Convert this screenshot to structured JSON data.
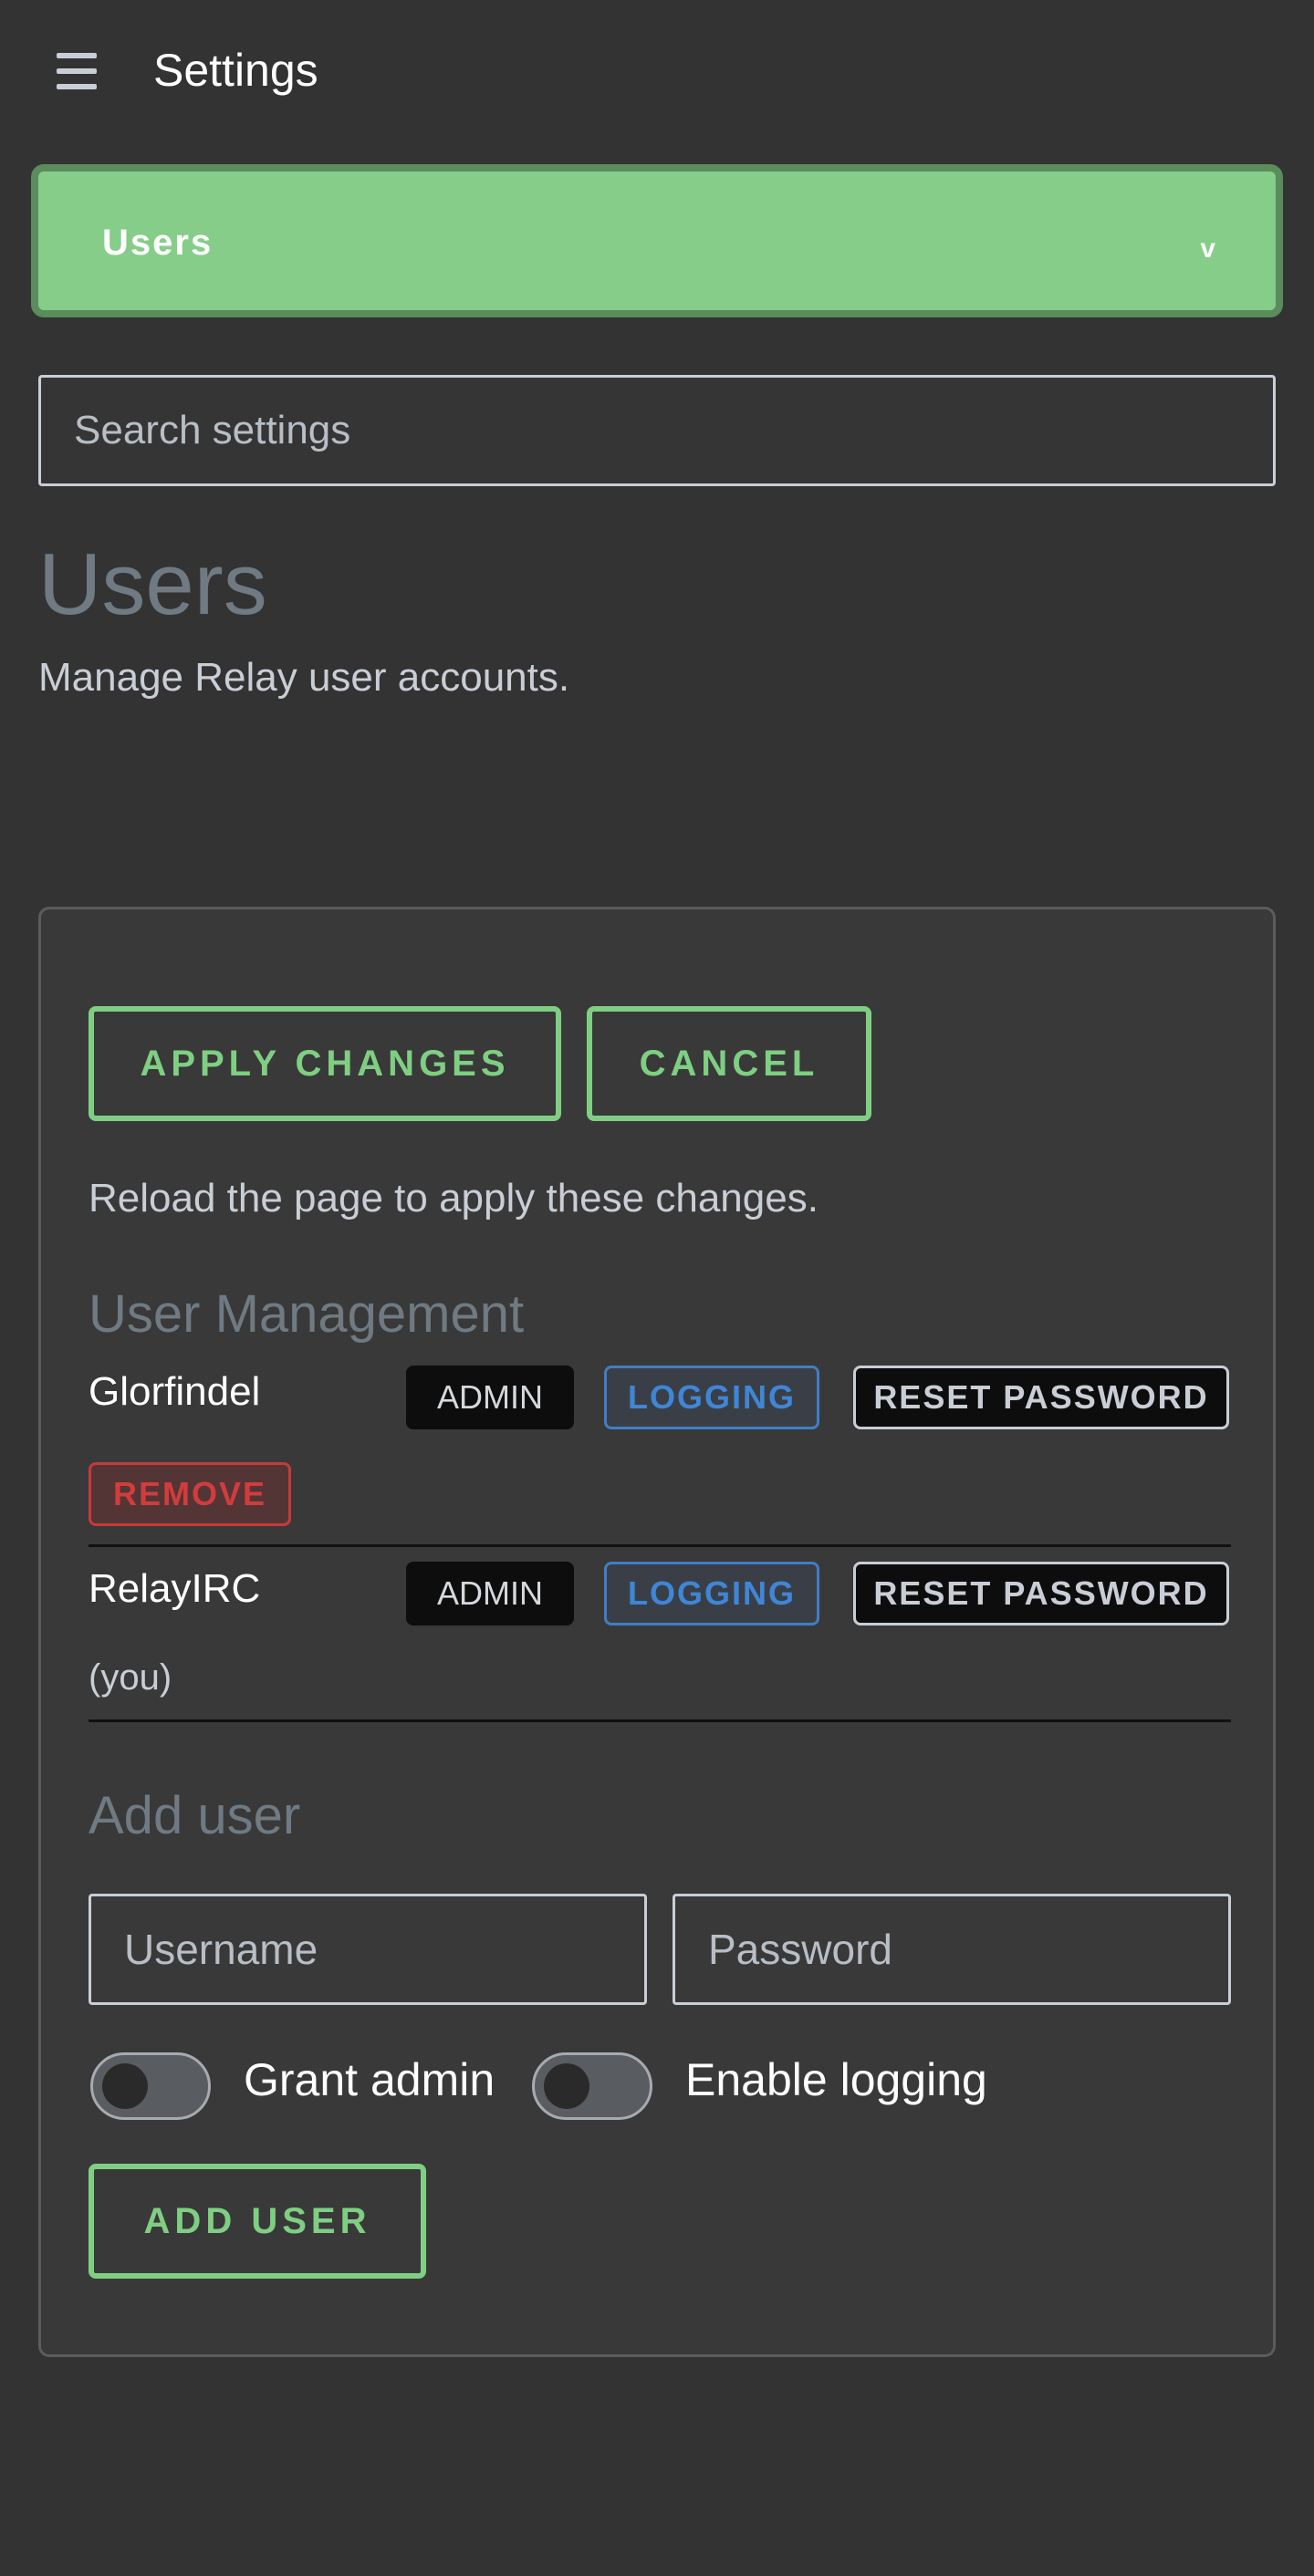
{
  "header": {
    "title": "Settings"
  },
  "section_select": {
    "selected": "Users"
  },
  "search": {
    "placeholder": "Search settings"
  },
  "page": {
    "heading": "Users",
    "description": "Manage Relay user accounts."
  },
  "actions": {
    "apply_label": "APPLY  CHANGES",
    "cancel_label": "CANCEL",
    "reload_note": "Reload the page to apply these changes."
  },
  "user_management": {
    "heading": "User Management",
    "users": [
      {
        "name": "Glorfindel",
        "admin_label": "ADMIN",
        "logging_label": "LOGGING",
        "reset_label": "RESET PASSWORD",
        "remove_label": "REMOVE"
      },
      {
        "name": "RelayIRC",
        "admin_label": "ADMIN",
        "logging_label": "LOGGING",
        "reset_label": "RESET PASSWORD",
        "note": "(you)"
      }
    ]
  },
  "add_user": {
    "heading": "Add user",
    "username_placeholder": "Username",
    "password_placeholder": "Password",
    "grant_admin_label": "Grant admin",
    "grant_admin_enabled": false,
    "enable_logging_label": "Enable logging",
    "enable_logging_enabled": false,
    "button_label": "ADD  USER"
  },
  "colors": {
    "background": "#333333",
    "accent_green": "#7fcf82",
    "select_green": "#86cd89",
    "logging_blue": "#3f86d6",
    "remove_red": "#d23c3c"
  }
}
